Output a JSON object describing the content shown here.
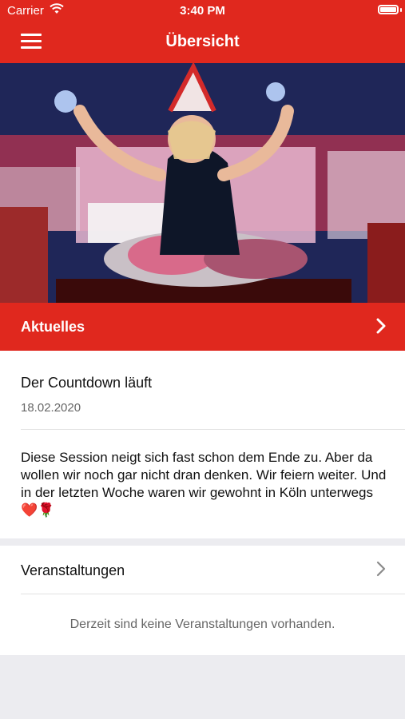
{
  "status_bar": {
    "carrier": "Carrier",
    "time": "3:40 PM"
  },
  "nav": {
    "title": "Übersicht",
    "menu_icon": "hamburger-menu-icon"
  },
  "hero": {
    "description_icon": "hero-photo"
  },
  "news": {
    "section_label": "Aktuelles",
    "headline": "Der Countdown läuft",
    "date": "18.02.2020",
    "body": "Diese Session neigt sich fast schon dem Ende zu. Aber da wollen wir noch gar nicht dran denken. Wir feiern weiter. Und in der letzten Woche waren wir gewohnt in Köln unterwegs ❤️🌹"
  },
  "events": {
    "section_label": "Veranstaltungen",
    "empty_text": "Derzeit sind keine Veranstaltungen vorhanden."
  },
  "colors": {
    "accent": "#e0281e",
    "background": "#ececf0"
  }
}
